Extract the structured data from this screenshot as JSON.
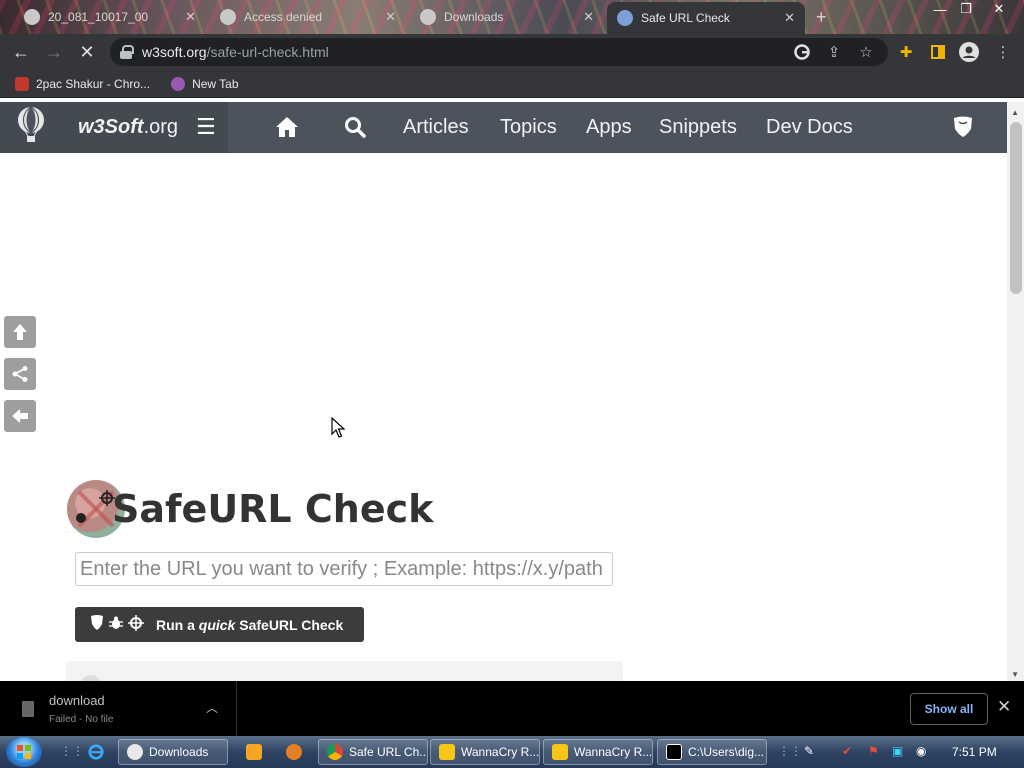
{
  "browser": {
    "tabs": [
      {
        "label": "20_081_10017_00",
        "active": false
      },
      {
        "label": "Access denied",
        "active": false
      },
      {
        "label": "Downloads",
        "active": false
      },
      {
        "label": "Safe URL Check",
        "active": true
      }
    ],
    "new_tab_symbol": "+",
    "window_controls": {
      "minimize": "—",
      "restore": "❐",
      "close": "✕"
    },
    "address": {
      "domain": "w3soft.org",
      "path": "/safe-url-check.html"
    },
    "bookmarks": [
      {
        "label": "2pac Shakur - Chro...",
        "color": "#c0392b"
      },
      {
        "label": "New Tab",
        "color": "#9b59b6"
      }
    ]
  },
  "site": {
    "brand_main": "w3Soft",
    "brand_suffix": ".org",
    "nav": [
      "Articles",
      "Topics",
      "Apps",
      "Snippets",
      "Dev Docs"
    ],
    "accent": "#4c535c",
    "title": "SafeURL Check",
    "input_placeholder": "Enter the URL you want to verify ; Example: https://x.y/path",
    "run_button": {
      "pre": "Run a ",
      "emph": "quick",
      "post": " SafeURL Check"
    }
  },
  "download_shelf": {
    "file_name": "download",
    "status": "Failed - No file",
    "show_all": "Show all"
  },
  "taskbar": {
    "apps": [
      {
        "label": "Downloads",
        "color": "#e8e8e8"
      },
      {
        "label": "Safe URL Ch...",
        "color": "#4caf50"
      },
      {
        "label": "WannaCry R...",
        "color": "#f5c518"
      },
      {
        "label": "WannaCry R...",
        "color": "#f5c518"
      },
      {
        "label": "C:\\Users\\dig...",
        "color": "#000000"
      }
    ],
    "clock": "7:51 PM"
  }
}
